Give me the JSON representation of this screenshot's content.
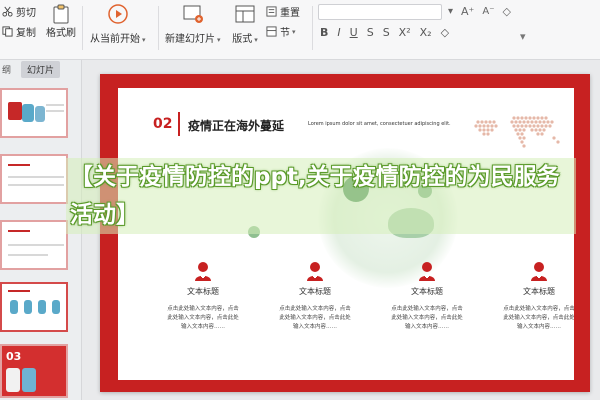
{
  "ribbon": {
    "cut": "剪切",
    "copy": "复制",
    "format_painter": "格式刷",
    "from_current": "从当前开始",
    "new_slide": "新建幻灯片",
    "layout": "版式",
    "section": "节",
    "reset": "重置",
    "left_cut_label": "切",
    "left_paste_label": " "
  },
  "thumbs": {
    "tab_outline": "纲",
    "tab_slides": "幻灯片",
    "badge_text": "03"
  },
  "slide": {
    "section_number": "02",
    "section_title": "疫情正在海外蔓延",
    "section_subtitle": "Lorem ipsum dolor sit amet, consectetuer adipiscing elit.",
    "cards": [
      {
        "title": "文本标题",
        "body": "点击此处输入文本内容，点击此处输入文本内容，点击此处输入文本内容……"
      },
      {
        "title": "文本标题",
        "body": "点击此处输入文本内容，点击此处输入文本内容，点击此处输入文本内容……"
      },
      {
        "title": "文本标题",
        "body": "点击此处输入文本内容，点击此处输入文本内容，点击此处输入文本内容……"
      },
      {
        "title": "文本标题",
        "body": "点击此处输入文本内容，点击此处输入文本内容，点击此处输入文本内容……"
      }
    ]
  },
  "overlay": {
    "headline": "【关于疫情防控的ppt,关于疫情防控的为民服务活动】"
  },
  "colors": {
    "accent_red": "#c72121",
    "virus_green": "#4a8f53"
  }
}
